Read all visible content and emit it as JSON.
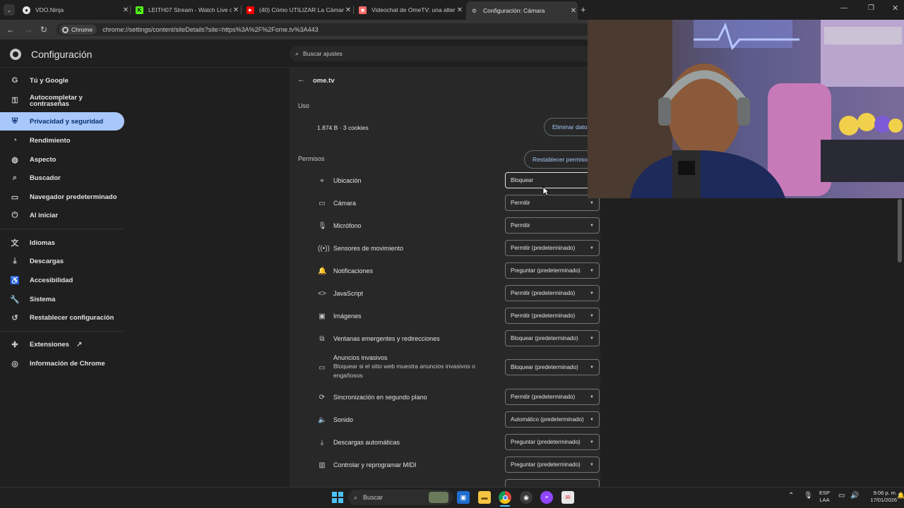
{
  "tabs": [
    {
      "title": "VDO.Ninja",
      "icon": "vdo-ninja-icon"
    },
    {
      "title": "LEITH07 Stream - Watch Live on",
      "icon": "kick-icon"
    },
    {
      "title": "(40) Cómo UTILIZAR La Cámara",
      "icon": "youtube-icon"
    },
    {
      "title": "Videochat de OmeTV: una alter",
      "icon": "ometv-icon"
    },
    {
      "title": "Configuración: Cámara",
      "icon": "settings-icon"
    }
  ],
  "toolbar": {
    "chrome_chip": "Chrome",
    "url": "chrome://settings/content/siteDetails?site=https%3A%2F%2Fome.tv%3A443"
  },
  "settings": {
    "title": "Configuración",
    "search_placeholder": "Buscar ajustes"
  },
  "sidebar": {
    "items": [
      {
        "label": "Tú y Google",
        "icon": "google-icon"
      },
      {
        "label": "Autocompletar y contraseñas",
        "icon": "key-icon"
      },
      {
        "label": "Privacidad y seguridad",
        "icon": "shield-icon"
      },
      {
        "label": "Rendimiento",
        "icon": "speedometer-icon"
      },
      {
        "label": "Aspecto",
        "icon": "palette-icon"
      },
      {
        "label": "Buscador",
        "icon": "search-icon"
      },
      {
        "label": "Navegador predeterminado",
        "icon": "browser-icon"
      },
      {
        "label": "Al iniciar",
        "icon": "power-icon"
      },
      {
        "label": "Idiomas",
        "icon": "translate-icon"
      },
      {
        "label": "Descargas",
        "icon": "download-icon"
      },
      {
        "label": "Accesibilidad",
        "icon": "accessibility-icon"
      },
      {
        "label": "Sistema",
        "icon": "wrench-icon"
      },
      {
        "label": "Restablecer configuración",
        "icon": "reset-icon"
      },
      {
        "label": "Extensiones",
        "icon": "puzzle-icon"
      },
      {
        "label": "Información de Chrome",
        "icon": "chrome-icon"
      }
    ]
  },
  "site": {
    "name": "ome.tv",
    "usage_heading": "Uso",
    "usage_value": "1.874 B · 3 cookies",
    "clear_button": "Eliminar datos",
    "permissions_heading": "Permisos",
    "reset_button": "Restablecer permisos"
  },
  "permissions": [
    {
      "label": "Ubicación",
      "value": "Bloquear",
      "icon": "location-icon"
    },
    {
      "label": "Cámara",
      "value": "Permitir",
      "icon": "camera-icon"
    },
    {
      "label": "Micrófono",
      "value": "Permitir",
      "icon": "microphone-icon"
    },
    {
      "label": "Sensores de movimiento",
      "value": "Permitir (predeterminado)",
      "icon": "sensors-icon"
    },
    {
      "label": "Notificaciones",
      "value": "Preguntar (predeterminado)",
      "icon": "bell-icon"
    },
    {
      "label": "JavaScript",
      "value": "Permitir (predeterminado)",
      "icon": "code-icon"
    },
    {
      "label": "Imágenes",
      "value": "Permitir (predeterminado)",
      "icon": "image-icon"
    },
    {
      "label": "Ventanas emergentes y redirecciones",
      "value": "Bloquear (predeterminado)",
      "icon": "popup-icon"
    },
    {
      "label": "Anuncios invasivos",
      "sublabel": "Bloquear si el sitio web muestra anuncios invasivos o engañosos",
      "value": "Bloquear (predeterminado)",
      "icon": "ads-icon"
    },
    {
      "label": "Sincronización en segundo plano",
      "value": "Permitir (predeterminado)",
      "icon": "sync-icon"
    },
    {
      "label": "Sonido",
      "value": "Automático (predeterminado)",
      "icon": "speaker-icon"
    },
    {
      "label": "Descargas automáticas",
      "value": "Preguntar (predeterminado)",
      "icon": "download-icon"
    },
    {
      "label": "Controlar y reprogramar MIDI",
      "value": "Preguntar (predeterminado)",
      "icon": "midi-icon"
    }
  ],
  "taskbar": {
    "search_label": "Buscar",
    "lang": "ESP",
    "lang2": "LAA",
    "time": "9:06 p. m.",
    "date": "17/01/2026"
  },
  "colors": {
    "accent": "#a8c7fa",
    "background": "#1f1f1f",
    "panel": "#282828"
  }
}
